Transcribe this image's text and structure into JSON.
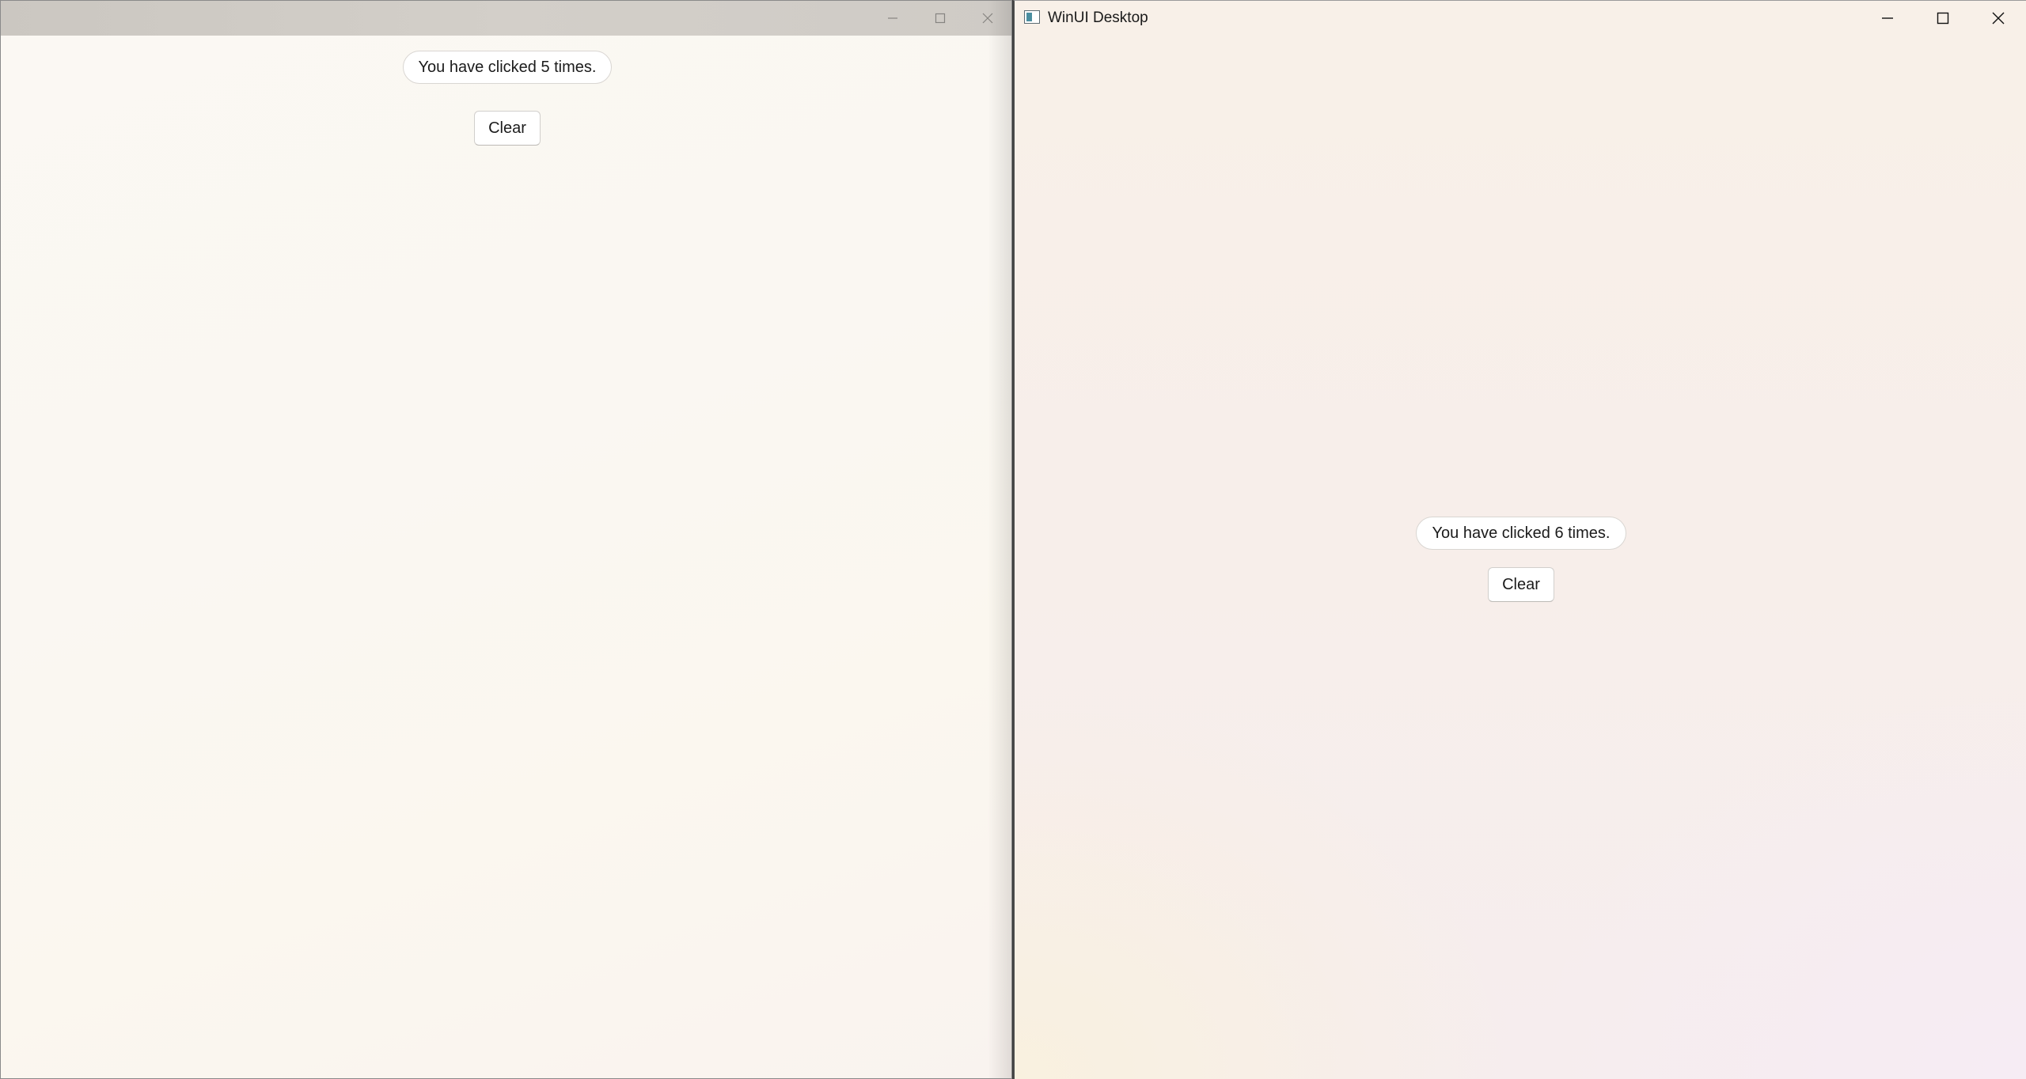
{
  "left_window": {
    "counter_text": "You have clicked 5 times.",
    "clear_label": "Clear"
  },
  "right_window": {
    "title": "WinUI Desktop",
    "app_icon": "app-window-icon",
    "counter_text": "You have clicked 6 times.",
    "clear_label": "Clear"
  },
  "caption_buttons": [
    "minimize-icon",
    "maximize-icon",
    "close-icon"
  ]
}
